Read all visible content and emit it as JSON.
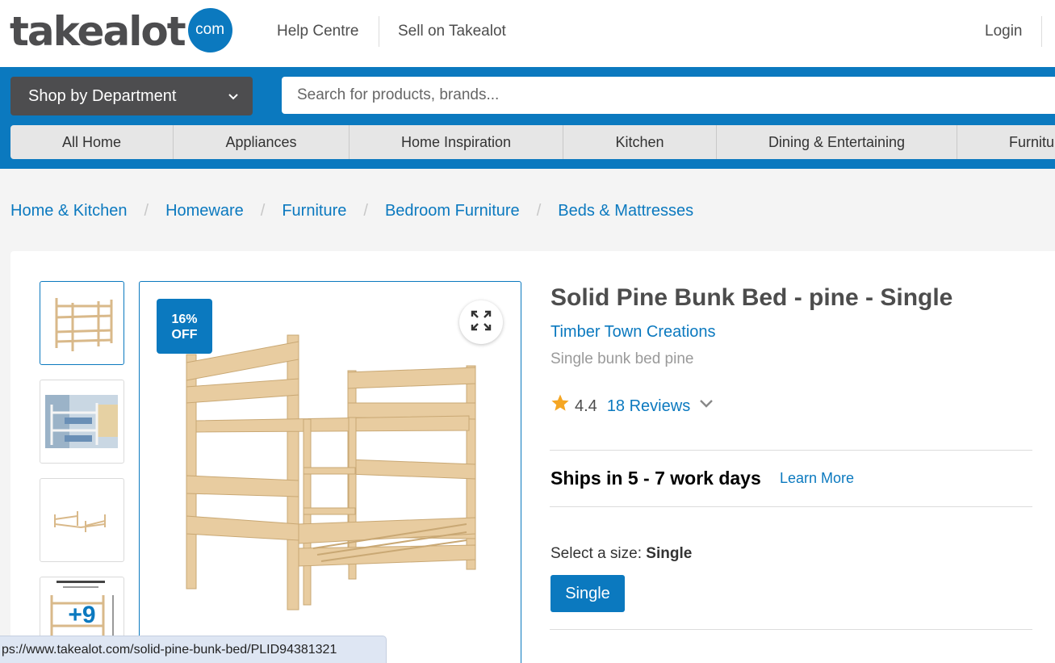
{
  "logo": {
    "word": "takealot",
    "com": "com"
  },
  "top_links": {
    "help": "Help Centre",
    "sell": "Sell on Takealot",
    "login": "Login"
  },
  "header": {
    "department_label": "Shop by Department",
    "search_placeholder": "Search for products, brands..."
  },
  "categories": [
    "All Home",
    "Appliances",
    "Home Inspiration",
    "Kitchen",
    "Dining & Entertaining",
    "Furnitu"
  ],
  "breadcrumb": [
    "Home & Kitchen",
    "Homeware",
    "Furniture",
    "Bedroom Furniture",
    "Beds & Mattresses"
  ],
  "gallery": {
    "more_count": "+9",
    "discount_line1": "16%",
    "discount_line2": "OFF"
  },
  "product": {
    "title": "Solid Pine Bunk Bed - pine - Single",
    "brand": "Timber Town Creations",
    "subtitle": "Single bunk bed pine",
    "rating": "4.4",
    "reviews": "18 Reviews",
    "shipping": "Ships in 5 - 7 work days",
    "learn_more": "Learn More",
    "size_prompt": "Select a size:",
    "size_selected": "Single",
    "size_option": "Single"
  },
  "status_url": "ps://www.takealot.com/solid-pine-bunk-bed/PLID94381321",
  "colors": {
    "brand_blue": "#0b79bf",
    "dark_grey": "#4d4d4f",
    "star": "#f5a623"
  }
}
